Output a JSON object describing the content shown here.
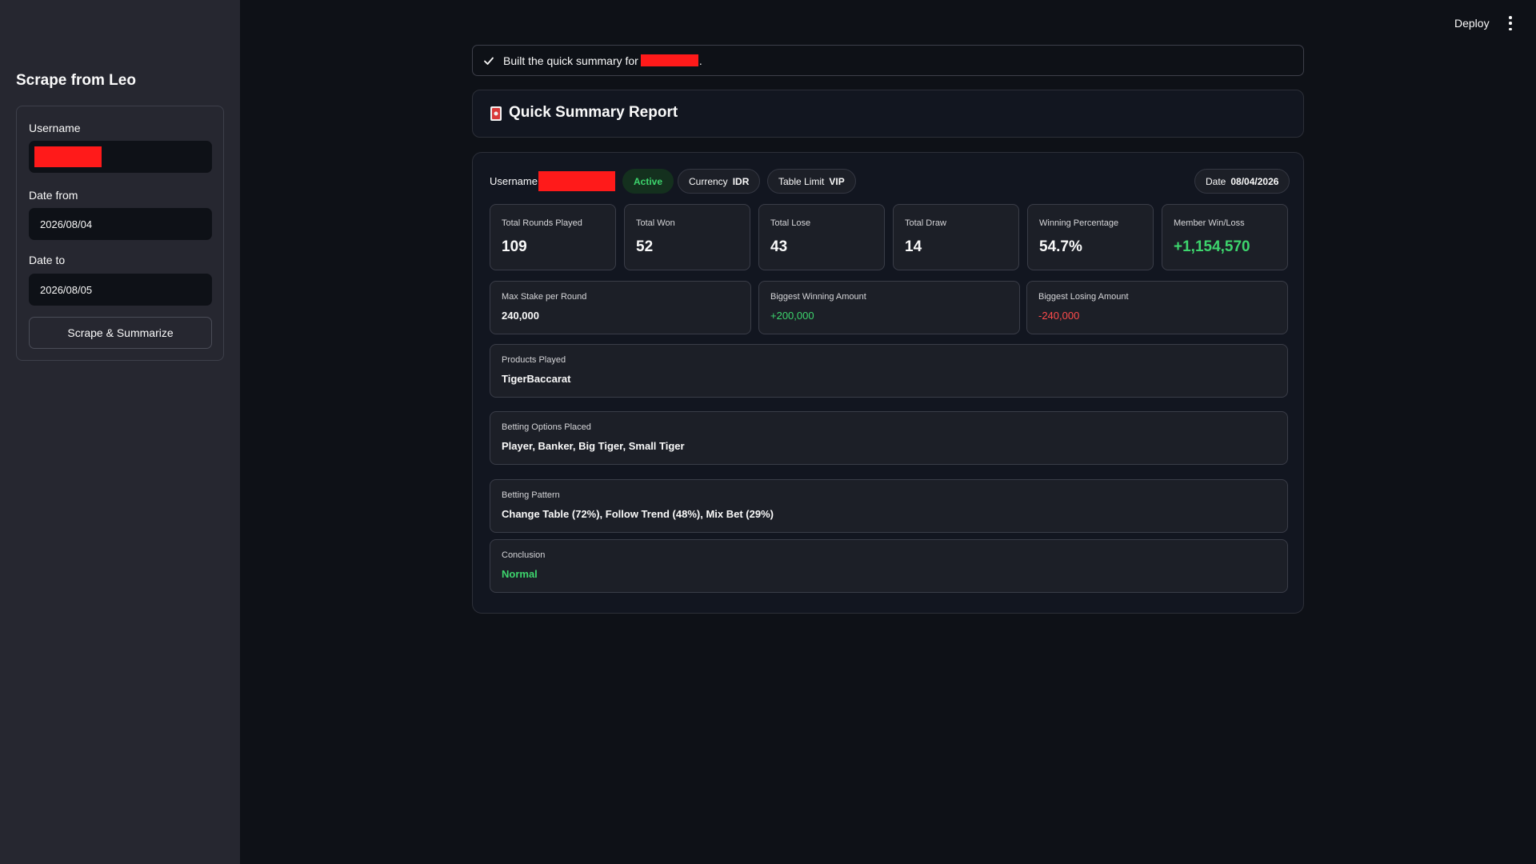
{
  "sidebar": {
    "title": "Scrape from Leo",
    "username_label": "Username",
    "date_from_label": "Date from",
    "date_from_value": "2026/08/04",
    "date_to_label": "Date to",
    "date_to_value": "2026/08/05",
    "submit_label": "Scrape & Summarize"
  },
  "topbar": {
    "deploy_label": "Deploy"
  },
  "toast": {
    "prefix": "Built the quick summary for",
    "suffix": "."
  },
  "report": {
    "title": "Quick Summary Report",
    "username_label": "Username:",
    "status": "Active",
    "currency_label": "Currency",
    "currency_value": "IDR",
    "table_limit_label": "Table Limit",
    "table_limit_value": "VIP",
    "date_label": "Date",
    "date_value": "08/04/2026",
    "stats": [
      {
        "label": "Total Rounds Played",
        "value": "109"
      },
      {
        "label": "Total Won",
        "value": "52"
      },
      {
        "label": "Total Lose",
        "value": "43"
      },
      {
        "label": "Total Draw",
        "value": "14"
      },
      {
        "label": "Winning Percentage",
        "value": "54.7%"
      },
      {
        "label": "Member Win/Loss",
        "value": "+1,154,570"
      }
    ],
    "amounts": [
      {
        "label": "Max Stake per Round",
        "value": "240,000"
      },
      {
        "label": "Biggest Winning Amount",
        "value": "+200,000"
      },
      {
        "label": "Biggest Losing Amount",
        "value": "-240,000"
      }
    ],
    "products": {
      "label": "Products Played",
      "value": "TigerBaccarat"
    },
    "betting_options": {
      "label": "Betting Options Placed",
      "value": "Player, Banker, Big Tiger, Small Tiger"
    },
    "betting_pattern": {
      "label": "Betting Pattern",
      "value": "Change Table (72%), Follow Trend (48%), Mix Bet (29%)"
    },
    "conclusion": {
      "label": "Conclusion",
      "value": "Normal"
    }
  },
  "colors": {
    "background": "#0e1117",
    "sidebar": "#262730",
    "positive": "#3dd56d",
    "negative": "#ff4b4b",
    "redaction": "#ff1a1a"
  }
}
